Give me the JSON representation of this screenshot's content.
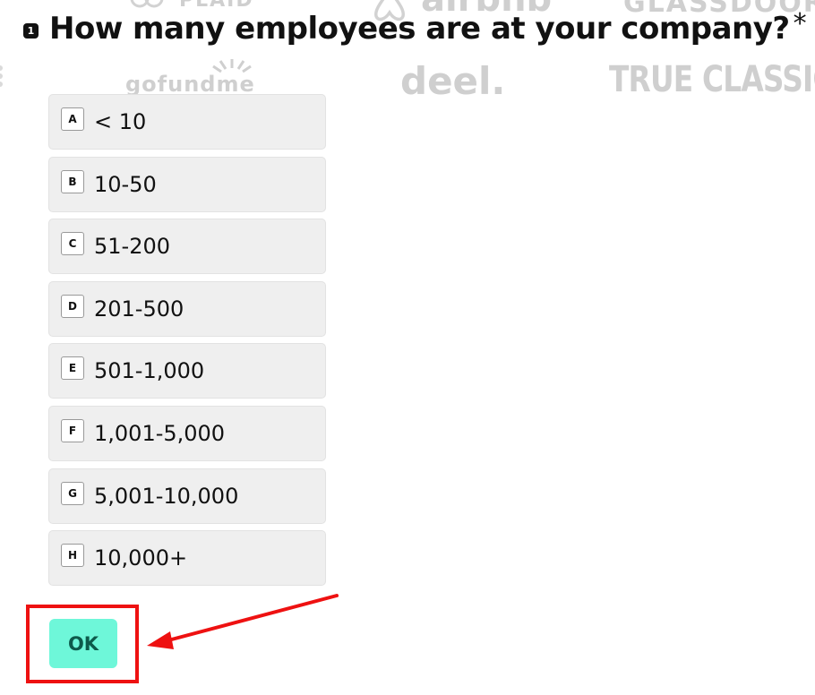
{
  "background_logos": {
    "plaid": "PLAID",
    "airbnb": "airbnb",
    "glassdoor": "GLASSDOOR",
    "gofundme": "gofundme",
    "deel": "deel.",
    "true_classic": "TRUE CLASSIC"
  },
  "question": {
    "number": "1",
    "text": "How many employees are at your company?",
    "required_marker": "*"
  },
  "options": [
    {
      "key": "A",
      "label": "< 10"
    },
    {
      "key": "B",
      "label": "10-50"
    },
    {
      "key": "C",
      "label": "51-200"
    },
    {
      "key": "D",
      "label": "201-500"
    },
    {
      "key": "E",
      "label": "501-1,000"
    },
    {
      "key": "F",
      "label": "1,001-5,000"
    },
    {
      "key": "G",
      "label": "5,001-10,000"
    },
    {
      "key": "H",
      "label": "10,000+"
    }
  ],
  "ok_button": {
    "label": "OK"
  },
  "colors": {
    "ok_button_bg": "#6ef7d9",
    "ok_button_text": "#0d5a4b",
    "annotation": "#ee1111",
    "option_bg": "#efefef"
  }
}
